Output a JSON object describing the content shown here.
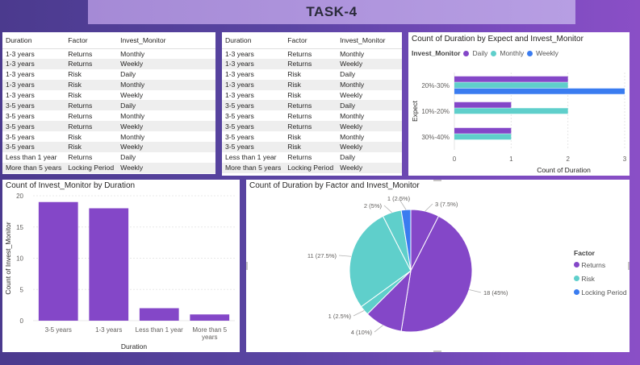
{
  "title": "TASK-4",
  "table1": {
    "columns": [
      "Duration",
      "Factor",
      "Invest_Monitor"
    ],
    "rows": [
      [
        "1-3 years",
        "Returns",
        "Monthly"
      ],
      [
        "1-3 years",
        "Returns",
        "Weekly"
      ],
      [
        "1-3 years",
        "Risk",
        "Daily"
      ],
      [
        "1-3 years",
        "Risk",
        "Monthly"
      ],
      [
        "1-3 years",
        "Risk",
        "Weekly"
      ],
      [
        "3-5 years",
        "Returns",
        "Daily"
      ],
      [
        "3-5 years",
        "Returns",
        "Monthly"
      ],
      [
        "3-5 years",
        "Returns",
        "Weekly"
      ],
      [
        "3-5 years",
        "Risk",
        "Monthly"
      ],
      [
        "3-5 years",
        "Risk",
        "Weekly"
      ],
      [
        "Less than 1 year",
        "Returns",
        "Daily"
      ],
      [
        "More than 5 years",
        "Locking Period",
        "Weekly"
      ]
    ]
  },
  "table2": {
    "columns": [
      "Duration",
      "Factor",
      "Invest_Monitor"
    ],
    "rows": [
      [
        "1-3 years",
        "Returns",
        "Monthly"
      ],
      [
        "1-3 years",
        "Returns",
        "Weekly"
      ],
      [
        "1-3 years",
        "Risk",
        "Daily"
      ],
      [
        "1-3 years",
        "Risk",
        "Monthly"
      ],
      [
        "1-3 years",
        "Risk",
        "Weekly"
      ],
      [
        "3-5 years",
        "Returns",
        "Daily"
      ],
      [
        "3-5 years",
        "Returns",
        "Monthly"
      ],
      [
        "3-5 years",
        "Returns",
        "Weekly"
      ],
      [
        "3-5 years",
        "Risk",
        "Monthly"
      ],
      [
        "3-5 years",
        "Risk",
        "Weekly"
      ],
      [
        "Less than 1 year",
        "Returns",
        "Daily"
      ],
      [
        "More than 5 years",
        "Locking Period",
        "Weekly"
      ]
    ]
  },
  "colors": {
    "purple": "#8447c8",
    "teal": "#5fcfcb",
    "blue": "#3a7cf0"
  },
  "chart_data": [
    {
      "type": "bar",
      "orientation": "horizontal",
      "title": "Count of Duration by Expect and Invest_Monitor",
      "legend_title": "Invest_Monitor",
      "legend_position": "top-left",
      "categories": [
        "20%-30%",
        "10%-20%",
        "30%-40%"
      ],
      "series": [
        {
          "name": "Daily",
          "color": "#8447c8",
          "values": [
            2,
            1,
            1
          ]
        },
        {
          "name": "Monthly",
          "color": "#5fcfcb",
          "values": [
            2,
            2,
            1
          ]
        },
        {
          "name": "Weekly",
          "color": "#3a7cf0",
          "values": [
            3,
            0,
            0
          ]
        }
      ],
      "ylabel": "Expect",
      "xlabel": "Count of Duration",
      "xlim": [
        0,
        3
      ],
      "xticks": [
        "0",
        "1",
        "2",
        "3"
      ]
    },
    {
      "type": "bar",
      "title": "Count of Invest_Monitor by Duration",
      "categories": [
        "3-5 years",
        "1-3 years",
        "Less than 1 year",
        "More than 5 years"
      ],
      "category_lines": [
        [
          "3-5 years"
        ],
        [
          "1-3 years"
        ],
        [
          "Less than 1 year"
        ],
        [
          "More than 5",
          "years"
        ]
      ],
      "values": [
        19,
        18,
        2,
        1
      ],
      "color": "#8447c8",
      "xlabel": "Duration",
      "ylabel": "Count of Invest_Monitor",
      "ylim": [
        0,
        20
      ],
      "yticks": [
        "0",
        "5",
        "10",
        "15",
        "20"
      ]
    },
    {
      "type": "pie",
      "title": "Count of Duration by Factor and Invest_Monitor",
      "legend_title": "Factor",
      "legend_position": "right",
      "legend": [
        {
          "name": "Returns",
          "color": "#8447c8"
        },
        {
          "name": "Risk",
          "color": "#5fcfcb"
        },
        {
          "name": "Locking Period",
          "color": "#3a7cf0"
        }
      ],
      "slices": [
        {
          "factor": "Returns",
          "value": 3,
          "label": "3 (7.5%)",
          "color": "#8447c8"
        },
        {
          "factor": "Returns",
          "value": 18,
          "label": "18 (45%)",
          "color": "#8447c8"
        },
        {
          "factor": "Returns",
          "value": 4,
          "label": "4 (10%)",
          "color": "#8447c8"
        },
        {
          "factor": "Risk",
          "value": 1,
          "label": "1 (2.5%)",
          "color": "#5fcfcb"
        },
        {
          "factor": "Risk",
          "value": 11,
          "label": "11 (27.5%)",
          "color": "#5fcfcb"
        },
        {
          "factor": "Risk",
          "value": 2,
          "label": "2 (5%)",
          "color": "#5fcfcb"
        },
        {
          "factor": "Locking Period",
          "value": 1,
          "label": "1 (2.5%)",
          "color": "#3a7cf0"
        }
      ]
    }
  ]
}
